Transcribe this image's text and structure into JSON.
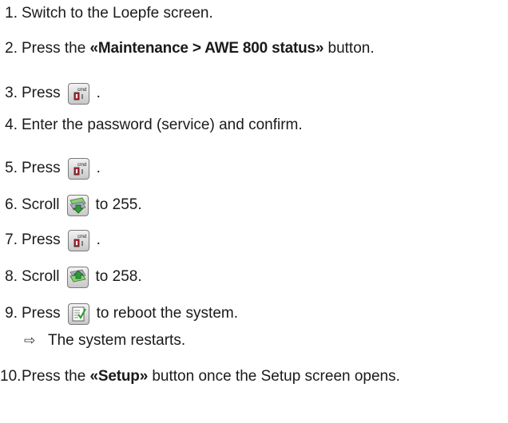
{
  "steps": [
    {
      "num": "1.",
      "text": "Switch to the Loepfe screen."
    },
    {
      "num": "2.",
      "pre": "Press the ",
      "bold": "«Maintenance > AWE 800 status»",
      "post": " button."
    },
    {
      "num": "3.",
      "pre": "Press",
      "icon": "cmd-key-icon",
      "post": "."
    },
    {
      "num": "4.",
      "text": "Enter the password (service) and confirm."
    },
    {
      "num": "5.",
      "pre": "Press",
      "icon": "cmd-key-icon",
      "post": "."
    },
    {
      "num": "6.",
      "pre": "Scroll",
      "icon": "scroll-down-icon",
      "post": "to 255."
    },
    {
      "num": "7.",
      "pre": "Press",
      "icon": "cmd-key-icon",
      "post": "."
    },
    {
      "num": "8.",
      "pre": "Scroll",
      "icon": "scroll-up-icon",
      "post": "to 258."
    },
    {
      "num": "9.",
      "pre": "Press",
      "icon": "checklist-icon",
      "post": "to reboot the system."
    },
    {
      "num": "10.",
      "pre": "Press the ",
      "bold": "«Setup»",
      "post": " button once the Setup screen opens."
    }
  ],
  "result": {
    "arrow": "⇨",
    "text": "The system restarts."
  },
  "icon_label": "cmd"
}
